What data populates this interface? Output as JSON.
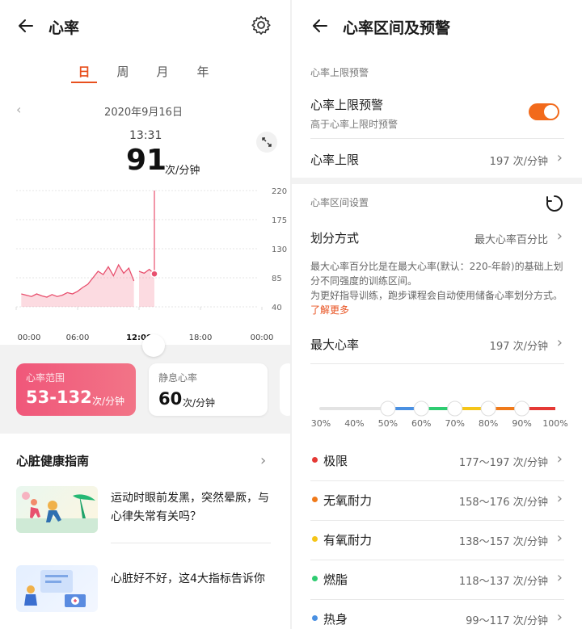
{
  "left": {
    "title": "心率",
    "tabs": [
      "日",
      "周",
      "月",
      "年"
    ],
    "date": "2020年9月16日",
    "time": "13:31",
    "current_value": "91",
    "current_unit": "次/分钟",
    "selected_time_label": "12:00",
    "range_card": {
      "label": "心率范围",
      "value": "53-132",
      "unit": "次/分钟"
    },
    "rest_card": {
      "label": "静息心率",
      "value": "60",
      "unit": "次/分钟"
    },
    "guide_title": "心脏健康指南",
    "articles": [
      {
        "title": "运动时眼前发黑，突然晕厥，与心律失常有关吗？"
      },
      {
        "title": "心脏好不好，这4大指标告诉你"
      }
    ]
  },
  "chart_data": {
    "type": "area",
    "x_tick_labels": [
      "00:00",
      "06:00",
      "12:00",
      "18:00",
      "00:00"
    ],
    "y_tick_labels": [
      "220",
      "175",
      "130",
      "85",
      "40"
    ],
    "ylim": [
      40,
      220
    ],
    "xlim_hours": [
      0,
      24
    ],
    "grid": true,
    "series": [
      {
        "x": [
          0.5,
          1,
          1.5,
          2,
          2.5,
          3,
          3.5,
          4,
          4.5,
          5,
          5.5,
          6,
          6.5,
          7,
          7.5,
          8,
          8.5,
          9,
          9.5,
          10,
          10.5,
          11,
          11.5,
          12,
          12.5,
          13,
          13.5
        ],
        "y": [
          60,
          58,
          56,
          60,
          57,
          55,
          59,
          56,
          58,
          62,
          60,
          64,
          70,
          75,
          85,
          95,
          90,
          102,
          88,
          105,
          92,
          100,
          80,
          95,
          92,
          98,
          91
        ]
      }
    ],
    "highlight_point": {
      "x": 13.5,
      "y": 91
    },
    "peak_marker": {
      "x": 13.5,
      "y": 132
    },
    "color": "#e8506e"
  },
  "right": {
    "title": "心率区间及预警",
    "section1": "心率上限预警",
    "alert_row": {
      "label": "心率上限预警",
      "desc": "高于心率上限时预警"
    },
    "limit_row": {
      "label": "心率上限",
      "value": "197 次/分钟"
    },
    "section2": "心率区间设置",
    "method_row": {
      "label": "划分方式",
      "value": "最大心率百分比"
    },
    "desc1": "最大心率百分比是在最大心率(默认：220-年龄)的基础上划分不同强度的训练区间。",
    "desc2": "为更好指导训练，跑步课程会自动使用储备心率划分方式。",
    "learn_more": "了解更多",
    "max_row": {
      "label": "最大心率",
      "value": "197 次/分钟"
    },
    "percent_labels": [
      "30%",
      "40%",
      "50%",
      "60%",
      "70%",
      "80%",
      "90%",
      "100%"
    ],
    "zones": [
      {
        "label": "极限",
        "value": "177～197 次/分钟",
        "color": "#e53935"
      },
      {
        "label": "无氧耐力",
        "value": "158～176 次/分钟",
        "color": "#f07a1a"
      },
      {
        "label": "有氧耐力",
        "value": "138～157 次/分钟",
        "color": "#f5c518"
      },
      {
        "label": "燃脂",
        "value": "118～137 次/分钟",
        "color": "#2ecc71"
      },
      {
        "label": "热身",
        "value": "99～117 次/分钟",
        "color": "#4a90e2"
      }
    ]
  }
}
